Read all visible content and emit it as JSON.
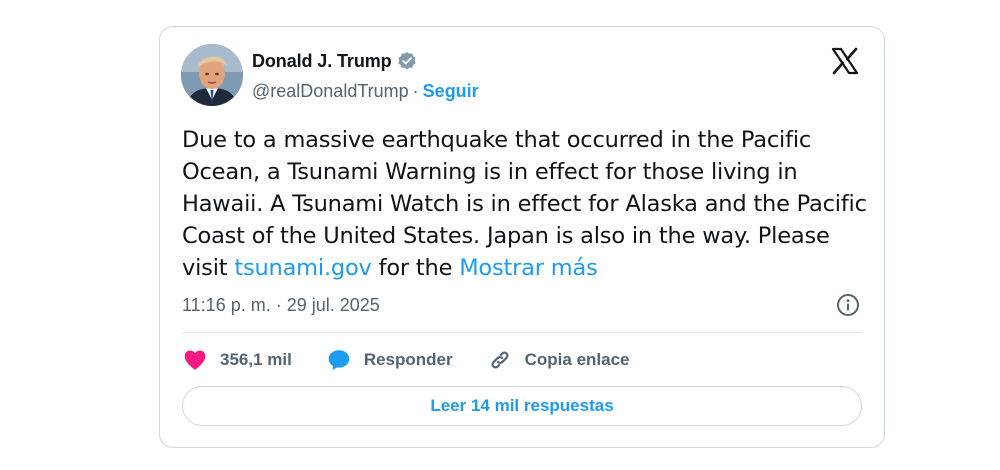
{
  "author": {
    "display_name": "Donald J. Trump",
    "handle": "@realDonaldTrump",
    "separator": "·",
    "follow_label": "Seguir",
    "verified": true
  },
  "tweet": {
    "text_before_link": "Due to a massive earthquake that occurred in the Pacific Ocean, a Tsunami Warning is in effect for those living in Hawaii. A Tsunami Watch is in effect for Alaska and the Pacific Coast of the United States. Japan is also in the way. Please visit ",
    "link_text": "tsunami.gov",
    "text_after_link": " for the ",
    "show_more_label": "Mostrar más",
    "timestamp": "11:16 p. m. · 29 jul. 2025"
  },
  "actions": {
    "likes_count": "356,1 mil",
    "reply_label": "Responder",
    "copy_link_label": "Copia enlace"
  },
  "read_replies_label": "Leer 14 mil respuestas",
  "icons": {
    "like": "heart-icon",
    "reply": "speech-bubble-icon",
    "copy_link": "link-icon",
    "info": "info-icon",
    "brand": "x-logo-icon",
    "verified": "verified-badge-icon"
  },
  "colors": {
    "accent": "#1d9bf0",
    "like": "#f91880",
    "text": "#0f1419",
    "secondary": "#536471",
    "border": "#cfd9de"
  }
}
